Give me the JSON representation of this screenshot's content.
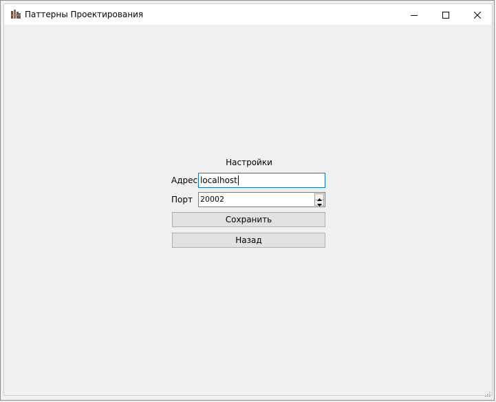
{
  "window": {
    "title": "Паттерны Проектирования",
    "icon": "app-icon",
    "controls": {
      "minimize": "minimize-icon",
      "maximize": "maximize-icon",
      "close": "close-icon"
    }
  },
  "settings": {
    "title": "Настройки",
    "address_label": "Адрес",
    "address_value": "localhost",
    "port_label": "Порт",
    "port_value": "20002",
    "save_label": "Сохранить",
    "back_label": "Назад"
  },
  "colors": {
    "focus_border": "#0078d7",
    "button_bg": "#e1e1e1",
    "window_bg": "#f0f0f0"
  }
}
